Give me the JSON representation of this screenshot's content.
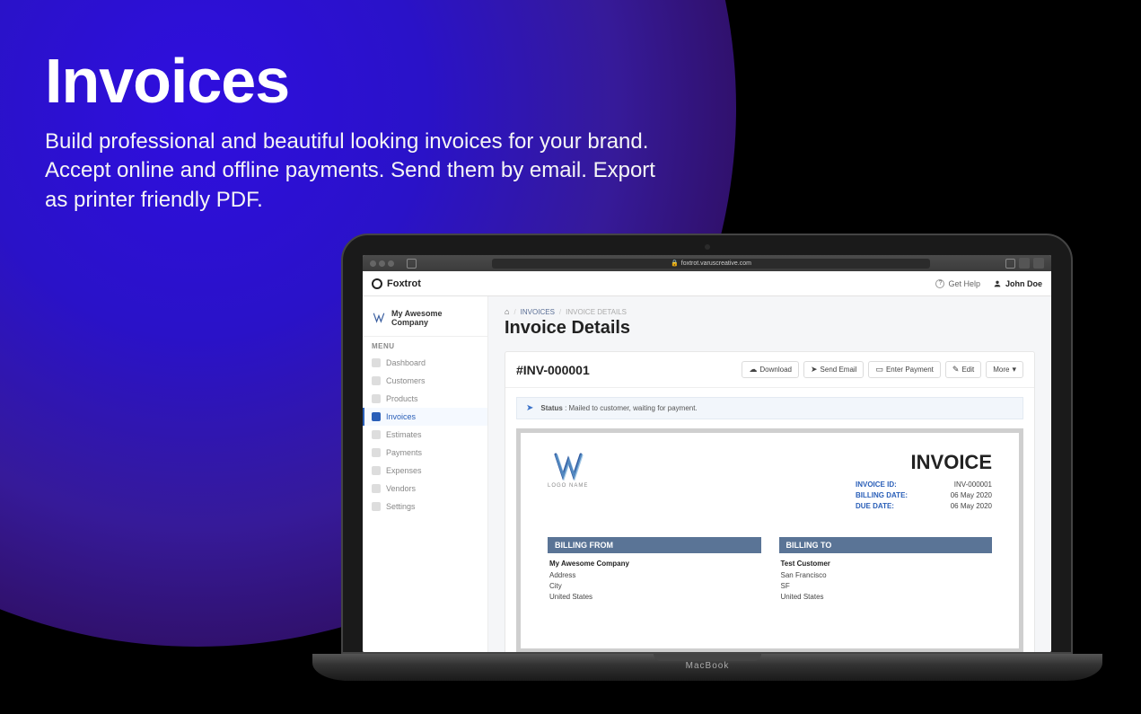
{
  "marketing": {
    "title": "Invoices",
    "subtitle": "Build professional and beautiful looking invoices for your brand. Accept online and offline payments. Send them by email. Export as printer friendly PDF."
  },
  "browser": {
    "url_text": "foxtrot.varuscreative.com"
  },
  "laptop": {
    "brand": "MacBook"
  },
  "header": {
    "brand": "Foxtrot",
    "help_label": "Get Help",
    "user_name": "John Doe"
  },
  "sidebar": {
    "company_name": "My Awesome Company",
    "menu_label": "MENU",
    "items": [
      {
        "label": "Dashboard"
      },
      {
        "label": "Customers"
      },
      {
        "label": "Products"
      },
      {
        "label": "Invoices",
        "active": true
      },
      {
        "label": "Estimates"
      },
      {
        "label": "Payments"
      },
      {
        "label": "Expenses"
      },
      {
        "label": "Vendors"
      },
      {
        "label": "Settings"
      }
    ]
  },
  "breadcrumbs": {
    "level1": "INVOICES",
    "level2": "INVOICE DETAILS"
  },
  "page": {
    "title": "Invoice Details"
  },
  "invoice": {
    "id": "#INV-000001",
    "actions": {
      "download": "Download",
      "send": "Send Email",
      "enter_payment": "Enter Payment",
      "edit": "Edit",
      "more": "More"
    },
    "status_label": "Status",
    "status_text": "Mailed to customer, waiting for payment."
  },
  "document": {
    "logo_caption": "LOGO NAME",
    "title": "INVOICE",
    "meta": {
      "invoice_id_label": "INVOICE ID:",
      "invoice_id_value": "INV-000001",
      "billing_date_label": "BILLING DATE:",
      "billing_date_value": "06 May 2020",
      "due_date_label": "DUE DATE:",
      "due_date_value": "06 May 2020"
    },
    "from": {
      "heading": "BILLING FROM",
      "name": "My Awesome Company",
      "line1": "Address",
      "line2": "City",
      "line3": "United States"
    },
    "to": {
      "heading": "BILLING TO",
      "name": "Test Customer",
      "line1": "San Francisco",
      "line2": "SF",
      "line3": "United States"
    }
  }
}
